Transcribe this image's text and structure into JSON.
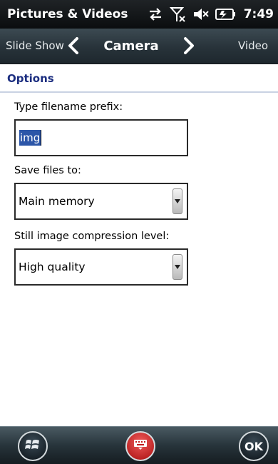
{
  "status_bar": {
    "app_title": "Pictures & Videos",
    "clock": "7:49",
    "icons": [
      "connectivity-arrows-icon",
      "signal-off-icon",
      "volume-muted-icon",
      "battery-charging-icon"
    ]
  },
  "tabs": {
    "previous": "Slide Show",
    "current": "Camera",
    "next": "Video"
  },
  "section": {
    "title": "Options"
  },
  "fields": {
    "prefix_label": "Type filename prefix:",
    "prefix_value": "img",
    "save_label": "Save files to:",
    "save_value": "Main memory",
    "compression_label": "Still image compression level:",
    "compression_value": "High quality"
  },
  "softkeys": {
    "ok_label": "OK"
  },
  "colors": {
    "accent": "#1c2e80",
    "selection": "#2c56a8",
    "keyboard_button": "#d62828"
  }
}
